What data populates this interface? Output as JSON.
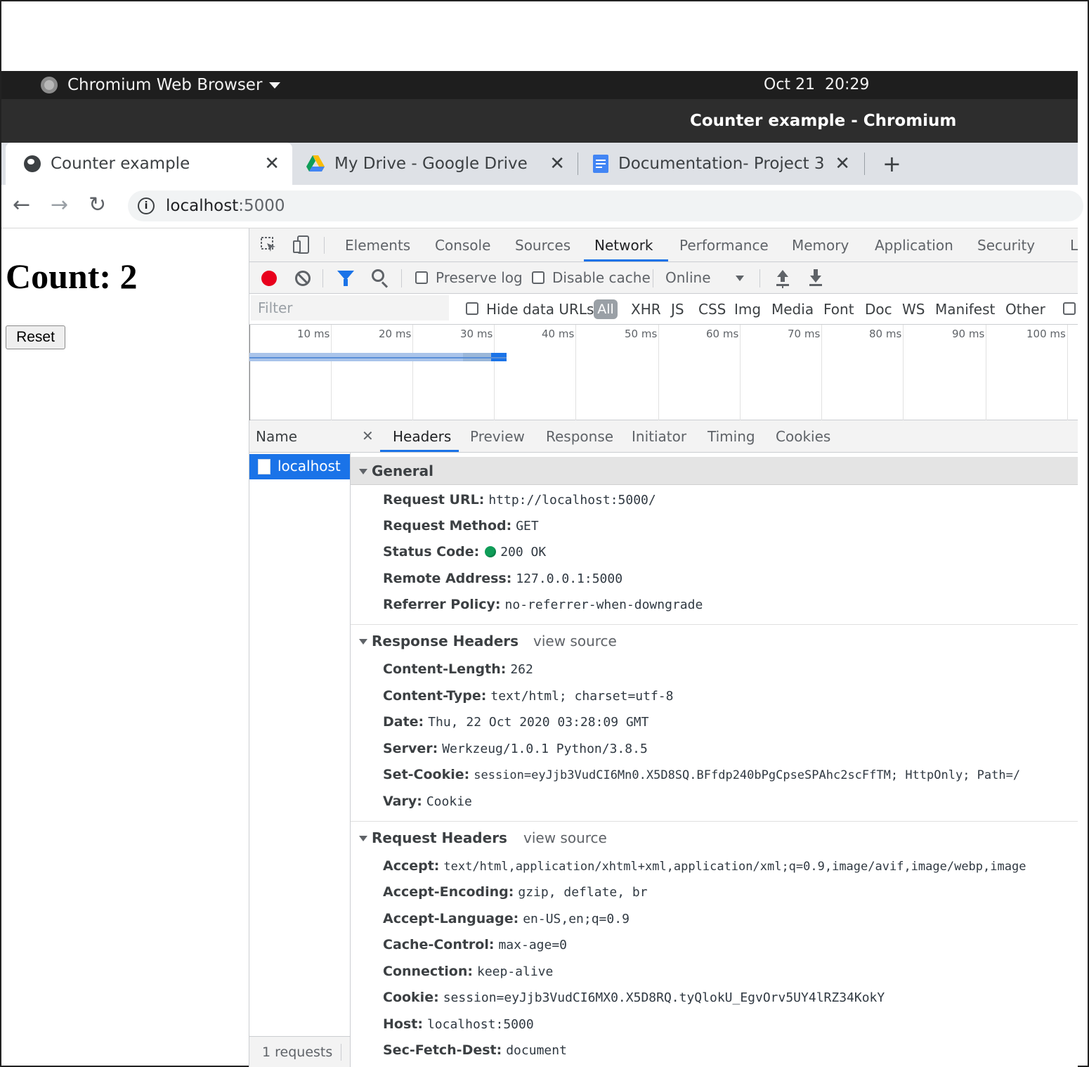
{
  "system_bar": {
    "app_name": "Chromium Web Browser",
    "datetime": "Oct 21  20:29"
  },
  "window": {
    "title": "Counter example - Chromium"
  },
  "browser_tabs": [
    {
      "title": "Counter example",
      "active": true,
      "icon": "globe-icon"
    },
    {
      "title": "My Drive - Google Drive",
      "active": false,
      "icon": "google-drive-icon"
    },
    {
      "title": "Documentation- Project 3",
      "active": false,
      "icon": "google-docs-icon"
    }
  ],
  "address_bar": {
    "host": "localhost",
    "port": ":5000"
  },
  "page": {
    "count_text": "Count: 2",
    "reset_label": "Reset"
  },
  "devtools": {
    "tabs": [
      "Elements",
      "Console",
      "Sources",
      "Network",
      "Performance",
      "Memory",
      "Application",
      "Security",
      "L"
    ],
    "selected_tab": "Network",
    "toolbar": {
      "preserve_log": "Preserve log",
      "disable_cache": "Disable cache",
      "throttle": "Online"
    },
    "filter_bar": {
      "placeholder": "Filter",
      "hide_data_urls": "Hide data URLs",
      "types": [
        "All",
        "XHR",
        "JS",
        "CSS",
        "Img",
        "Media",
        "Font",
        "Doc",
        "WS",
        "Manifest",
        "Other"
      ]
    },
    "timeline_ticks": [
      "10 ms",
      "20 ms",
      "30 ms",
      "40 ms",
      "50 ms",
      "60 ms",
      "70 ms",
      "80 ms",
      "90 ms",
      "100 ms"
    ],
    "colors": {
      "accent": "#1a73e8",
      "record": "#e8001c",
      "status_ok": "#0f9d58"
    },
    "name_column": {
      "header": "Name",
      "rows": [
        "localhost"
      ],
      "footer": "1 requests"
    },
    "detail_tabs": [
      "Headers",
      "Preview",
      "Response",
      "Initiator",
      "Timing",
      "Cookies"
    ],
    "selected_detail_tab": "Headers",
    "general": {
      "title": "General",
      "rows": [
        {
          "key": "Request URL:",
          "value": "http://localhost:5000/"
        },
        {
          "key": "Request Method:",
          "value": "GET"
        },
        {
          "key": "Status Code:",
          "value": "200 OK"
        },
        {
          "key": "Remote Address:",
          "value": "127.0.0.1:5000"
        },
        {
          "key": "Referrer Policy:",
          "value": "no-referrer-when-downgrade"
        }
      ]
    },
    "response_headers": {
      "title": "Response Headers",
      "view_source": "view source",
      "rows": [
        {
          "key": "Content-Length:",
          "value": "262"
        },
        {
          "key": "Content-Type:",
          "value": "text/html; charset=utf-8"
        },
        {
          "key": "Date:",
          "value": "Thu, 22 Oct 2020 03:28:09 GMT"
        },
        {
          "key": "Server:",
          "value": "Werkzeug/1.0.1 Python/3.8.5"
        },
        {
          "key": "Set-Cookie:",
          "value": "session=eyJjb3VudCI6Mn0.X5D8SQ.BFfdp240bPgCpseSPAhc2scFfTM; HttpOnly; Path=/"
        },
        {
          "key": "Vary:",
          "value": "Cookie"
        }
      ]
    },
    "request_headers": {
      "title": "Request Headers",
      "view_source": "view source",
      "rows": [
        {
          "key": "Accept:",
          "value": "text/html,application/xhtml+xml,application/xml;q=0.9,image/avif,image/webp,image"
        },
        {
          "key": "Accept-Encoding:",
          "value": "gzip, deflate, br"
        },
        {
          "key": "Accept-Language:",
          "value": "en-US,en;q=0.9"
        },
        {
          "key": "Cache-Control:",
          "value": "max-age=0"
        },
        {
          "key": "Connection:",
          "value": "keep-alive"
        },
        {
          "key": "Cookie:",
          "value": "session=eyJjb3VudCI6MX0.X5D8RQ.tyQlokU_EgvOrv5UY4lRZ34KokY"
        },
        {
          "key": "Host:",
          "value": "localhost:5000"
        },
        {
          "key": "Sec-Fetch-Dest:",
          "value": "document"
        }
      ]
    }
  }
}
